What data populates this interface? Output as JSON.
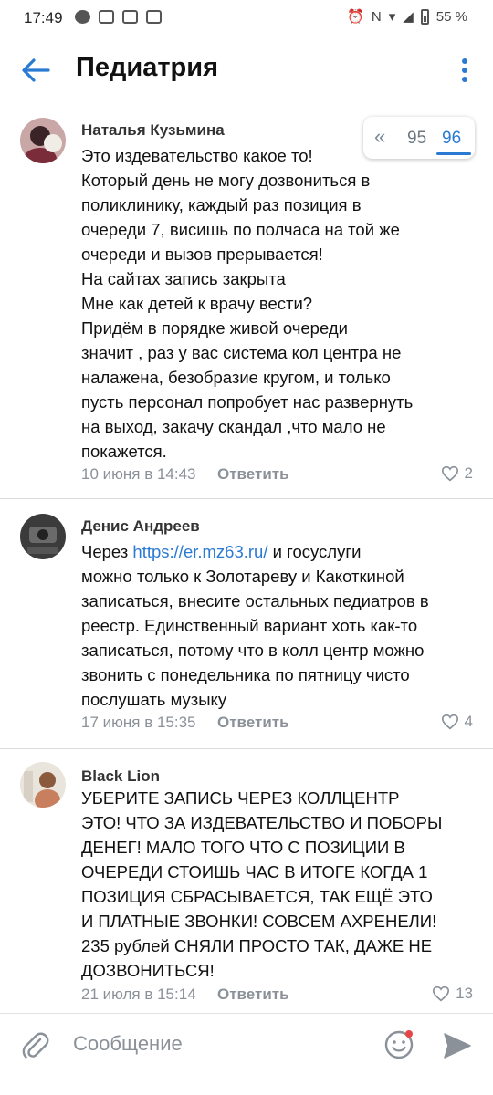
{
  "status_bar": {
    "time": "17:49",
    "battery": "55 %"
  },
  "header": {
    "title": "Педиатрия"
  },
  "pager": {
    "prev": "«",
    "page_a": "95",
    "page_b": "96"
  },
  "comments": [
    {
      "author": "Наталья Кузьмина",
      "text": "Это издевательство какое то!\nКоторый день не могу дозвониться в\nполиклинику, каждый раз позиция в\nочереди 7, висишь по полчаса на той же\nочереди и вызов прерывается!\nНа сайтах запись закрыта\nМне как детей к врачу вести?\nПридём в порядке живой очереди\nзначит , раз у вас система кол центра не\nналажена, безобразие кругом, и только\nпусть персонал попробует нас развернуть\nна выход, закачу скандал ,что мало не\nпокажется.",
      "date": "10 июня в 14:43",
      "reply": "Ответить",
      "likes": "2"
    },
    {
      "author": "Денис Андреев",
      "text_before": "Через ",
      "link": "https://er.mz63.ru/",
      "text_after": " и госуслуги\nможно только к Золотареву и Какоткиной\nзаписаться, внесите остальных педиатров в\nреестр. Единственный вариант хоть как-то\nзаписаться, потому что в колл центр можно\nзвонить с понедельника по пятницу чисто\nпослушать музыку",
      "date": "17 июня в 15:35",
      "reply": "Ответить",
      "likes": "4"
    },
    {
      "author": "Black Lion",
      "text": "УБЕРИТЕ ЗАПИСЬ ЧЕРЕЗ КОЛЛЦЕНТР\nЭТО! ЧТО ЗА ИЗДЕВАТЕЛЬСТВО И ПОБОРЫ\nДЕНЕГ! МАЛО ТОГО ЧТО С ПОЗИЦИИ В\nОЧЕРЕДИ СТОИШЬ ЧАС  В ИТОГЕ КОГДА 1\nПОЗИЦИЯ СБРАСЫВАЕТСЯ, ТАК ЕЩЁ ЭТО\nИ ПЛАТНЫЕ ЗВОНКИ! СОВСЕМ АХРЕНЕЛИ!\n235 рублей СНЯЛИ ПРОСТО ТАК, ДАЖЕ НЕ\nДОЗВОНИТЬСЯ!",
      "date": "21 июля в 15:14",
      "reply": "Ответить",
      "likes": "13"
    }
  ],
  "composer": {
    "placeholder": "Сообщение"
  },
  "colors": {
    "accent": "#2a7ad3",
    "meta": "#8a9199",
    "divider": "#dcdcdc"
  },
  "icons": [
    "back-arrow-icon",
    "more-vertical-icon",
    "heart-icon",
    "paperclip-icon",
    "emoji-icon",
    "send-icon"
  ]
}
